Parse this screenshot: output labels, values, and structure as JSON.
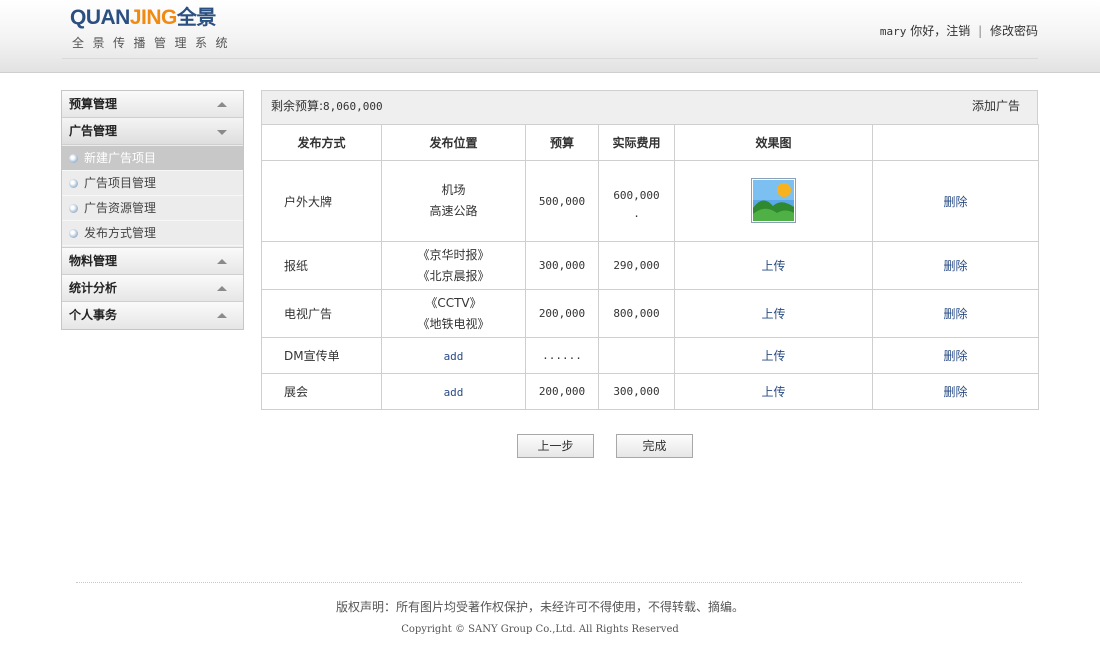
{
  "header": {
    "logo_latin_a": "QUAN",
    "logo_latin_b": "JING",
    "logo_cn": "全景",
    "subtitle": "全景传播管理系统",
    "user": "mary",
    "greeting": "你好，",
    "logout": "注销",
    "separator": "|",
    "change_password": "修改密码"
  },
  "sidebar": {
    "sections": [
      {
        "label": "预算管理",
        "expanded": false
      },
      {
        "label": "广告管理",
        "expanded": true,
        "items": [
          {
            "label": "新建广告项目",
            "selected": true
          },
          {
            "label": "广告项目管理",
            "selected": false
          },
          {
            "label": "广告资源管理",
            "selected": false
          },
          {
            "label": "发布方式管理",
            "selected": false
          }
        ]
      },
      {
        "label": "物料管理",
        "expanded": false
      },
      {
        "label": "统计分析",
        "expanded": false
      },
      {
        "label": "个人事务",
        "expanded": false
      }
    ]
  },
  "main": {
    "budget_label": "剩余预算:",
    "budget_value": "8,060,000",
    "add_ad_link": "添加广告",
    "columns": [
      "发布方式",
      "发布位置",
      "预算",
      "实际费用",
      "效果图",
      ""
    ],
    "rows": [
      {
        "method": "户外大牌",
        "location_1": "机场",
        "location_2": "高速公路",
        "budget": "500,000",
        "actual": "600,000",
        "actual_note": ".",
        "effect": "image",
        "effect_icon": "landscape-thumbnail-icon",
        "delete": "删除"
      },
      {
        "method": "报纸",
        "location_1": "《京华时报》",
        "location_2": "《北京晨报》",
        "budget": "300,000",
        "actual": "290,000",
        "effect": "上传",
        "delete": "删除"
      },
      {
        "method": "电视广告",
        "location_1": "《CCTV》",
        "location_2": "《地铁电视》",
        "budget": "200,000",
        "actual": "800,000",
        "effect": "上传",
        "delete": "删除"
      },
      {
        "method": "DM宣传单",
        "location_1": "add",
        "budget": "......",
        "actual": "",
        "effect": "上传",
        "delete": "删除"
      },
      {
        "method": "展会",
        "location_1": "add",
        "budget": "200,000",
        "actual": "300,000",
        "effect": "上传",
        "delete": "删除"
      }
    ]
  },
  "actions": {
    "prev": "上一步",
    "finish": "完成"
  },
  "footer": {
    "copyright_cn": "版权声明：所有图片均受著作权保护，未经许可不得使用，不得转载、摘编。",
    "copyright_en": "Copyright © SANY Group Co.,Ltd. All Rights Reserved"
  },
  "colors": {
    "brand_blue": "#2b4f80",
    "brand_orange": "#f08a13",
    "link": "#2a4c86",
    "selected_item": "#c8c8c8"
  }
}
